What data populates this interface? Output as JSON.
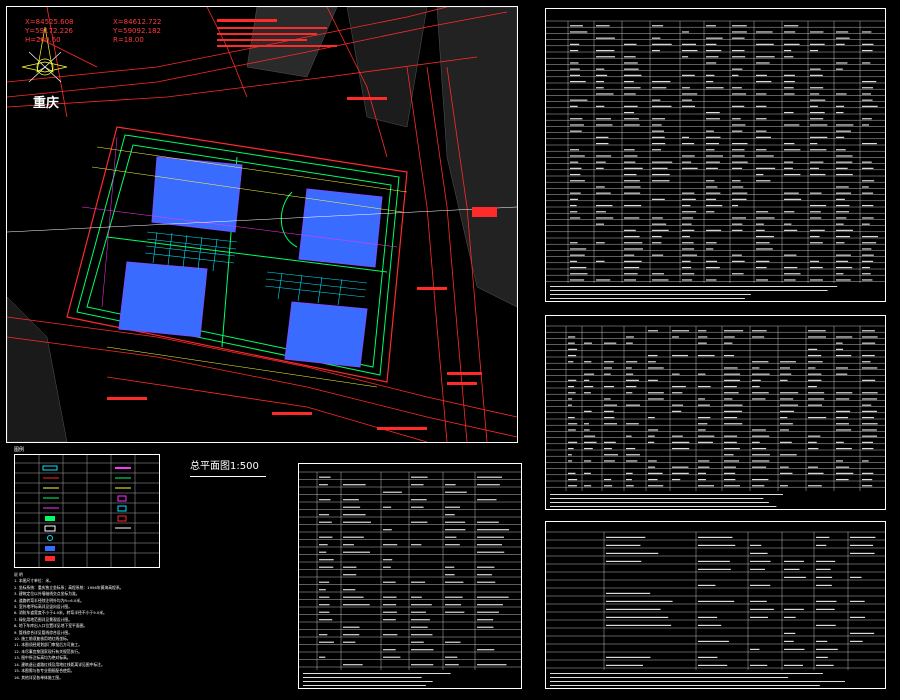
{
  "drawing": {
    "title": "总平面图1:500",
    "city_label": "重庆",
    "coordinates": [
      "X=84525.608",
      "Y=59172.226",
      "H=280.60",
      "X=84612.722",
      "Y=59092.182",
      "R=18.00"
    ],
    "legend_heading": "图例",
    "notes_heading": "说 明",
    "notes": [
      "1. 本图尺寸单位：米。",
      "2. 坐标系统：重庆独立坐标系；高程系统：1956年黄海高程系。",
      "3. 建筑定位以外墙轴线交点坐标为准。",
      "4. 道路转弯半径除注明外均为R=6.0米。",
      "5. 室外地坪标高详见竖向设计图。",
      "6. 消防车道宽度不小于4.0米，转弯半径不小于9.0米。",
      "7. 绿化用地范围详见景观设计图。",
      "8. 地下车库出入口位置详见地下室平面图。",
      "9. 管线综合详见管线综合设计图。",
      "10. 施工前须复核用地红线坐标。",
      "11. 本图须经规划部门审批后方可施工。",
      "12. 未尽事宜按国家现行有关规范执行。",
      "13. 图中所注标高均为绝对标高。",
      "14. 建筑退让道路红线及用地红线距离详见图中标注。",
      "15. 本图需与各专业图纸配合使用。",
      "16. 其他详见各单体施工图。"
    ]
  },
  "colors": {
    "boundary": "#ff2a2a",
    "road": "#00ff66",
    "building": "#7b4dff",
    "roof": "#3a6bff",
    "parking": "#00e5ff",
    "pipe": "#ffff33",
    "text": "#ffffff",
    "background": "#000000"
  },
  "panels": [
    "site-plan",
    "legend-table",
    "economic-indicators-table",
    "building-schedule-table",
    "parking-schedule-table",
    "landscape-table"
  ]
}
